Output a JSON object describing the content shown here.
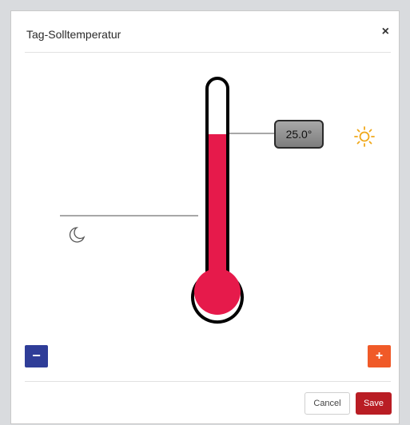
{
  "dialog": {
    "title": "Tag-Solltemperatur",
    "close_label": "×"
  },
  "thermometer": {
    "setpoint_label": "25.0°",
    "fill_color": "#e61a4b",
    "day_icon": "sun-icon",
    "night_icon": "moon-icon"
  },
  "controls": {
    "decrease_label": "−",
    "increase_label": "+",
    "decrease_color": "#2f3d98",
    "increase_color": "#f05a28"
  },
  "footer": {
    "cancel_label": "Cancel",
    "save_label": "Save",
    "save_color": "#b91d24"
  }
}
